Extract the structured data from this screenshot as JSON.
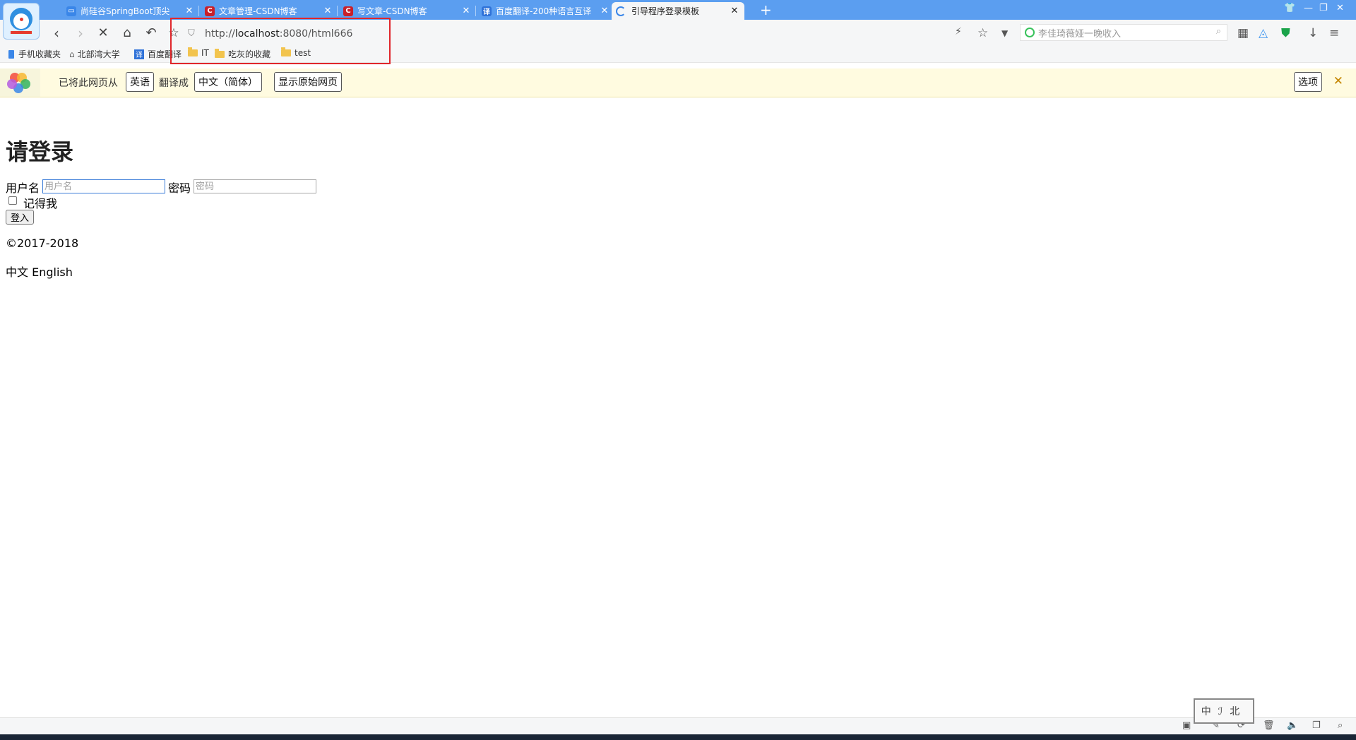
{
  "tabs": [
    {
      "label": "尚硅谷SpringBoot顶尖",
      "icon": "tv-icon",
      "color": "#3a86e8"
    },
    {
      "label": "文章管理-CSDN博客",
      "icon": "csdn-icon",
      "color": "#c9202a"
    },
    {
      "label": "写文章-CSDN博客",
      "icon": "csdn-icon",
      "color": "#c9202a"
    },
    {
      "label": "百度翻译-200种语言互译",
      "icon": "translate-icon",
      "color": "#2f72d8"
    },
    {
      "label": "引导程序登录模板",
      "icon": "loading-spinner-icon",
      "color": "#3a86e8"
    }
  ],
  "icons": {
    "csdn": "C",
    "translate": "译"
  },
  "address": {
    "prefix": "http://",
    "host": "localhost",
    "rest": ":8080/html666"
  },
  "search": {
    "placeholder": "李佳琦薇娅一晚收入"
  },
  "bookmarks": [
    "手机收藏夹",
    "北部湾大学",
    "百度翻译",
    "IT",
    "吃灰的收藏",
    "test"
  ],
  "translate_bar": {
    "prefix": "已将此网页从",
    "from_lang": "英语",
    "middle": "翻译成",
    "to_lang": "中文（简体）",
    "show_original": "显示原始网页",
    "options": "选项"
  },
  "page": {
    "title": "请登录",
    "username_label": "用户名",
    "username_placeholder": "用户名",
    "password_label": "密码",
    "password_placeholder": "密码",
    "remember_label": "记得我",
    "login_button": "登入",
    "copyright": "©2017-2018",
    "lang_zh": "中文",
    "lang_en": "English"
  },
  "stamp_text": "中ℐ北"
}
